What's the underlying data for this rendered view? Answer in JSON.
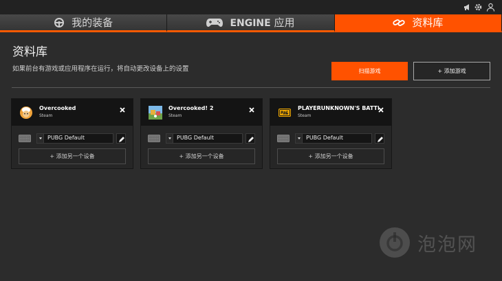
{
  "topbar": {
    "icons": [
      "megaphone-icon",
      "gear-icon",
      "user-icon"
    ]
  },
  "tabs": [
    {
      "label": "我的装备",
      "icon": "steering-wheel-icon",
      "active": false
    },
    {
      "label_bold": "ENGINE",
      "label": "应用",
      "icon": "gamepad-icon",
      "active": false
    },
    {
      "label": "资料库",
      "icon": "link-icon",
      "active": true
    }
  ],
  "page": {
    "title": "资料库",
    "description": "如果前台有游戏或应用程序在运行，将自动更改设备上的设置",
    "scan_button": "扫描游戏",
    "add_game_button": "+ 添加游戏"
  },
  "cards": [
    {
      "name": "Overcooked",
      "platform": "Steam",
      "profile": "PUBG Default",
      "add_device": "+ 添加另一个设备",
      "icon": "overcooked-icon"
    },
    {
      "name": "Overcooked! 2",
      "platform": "Steam",
      "profile": "PUBG Default",
      "add_device": "+ 添加另一个设备",
      "icon": "overcooked2-icon"
    },
    {
      "name": "PLAYERUNKNOWN'S BATTLEGROUNDS",
      "platform": "Steam",
      "profile": "PUBG Default",
      "add_device": "+ 添加另一个设备",
      "icon": "pubg-icon"
    }
  ],
  "watermark": {
    "text": "泡泡网"
  },
  "colors": {
    "accent": "#ff5200",
    "background": "#2c2c2c",
    "card": "#262626",
    "card_header": "#141414"
  }
}
